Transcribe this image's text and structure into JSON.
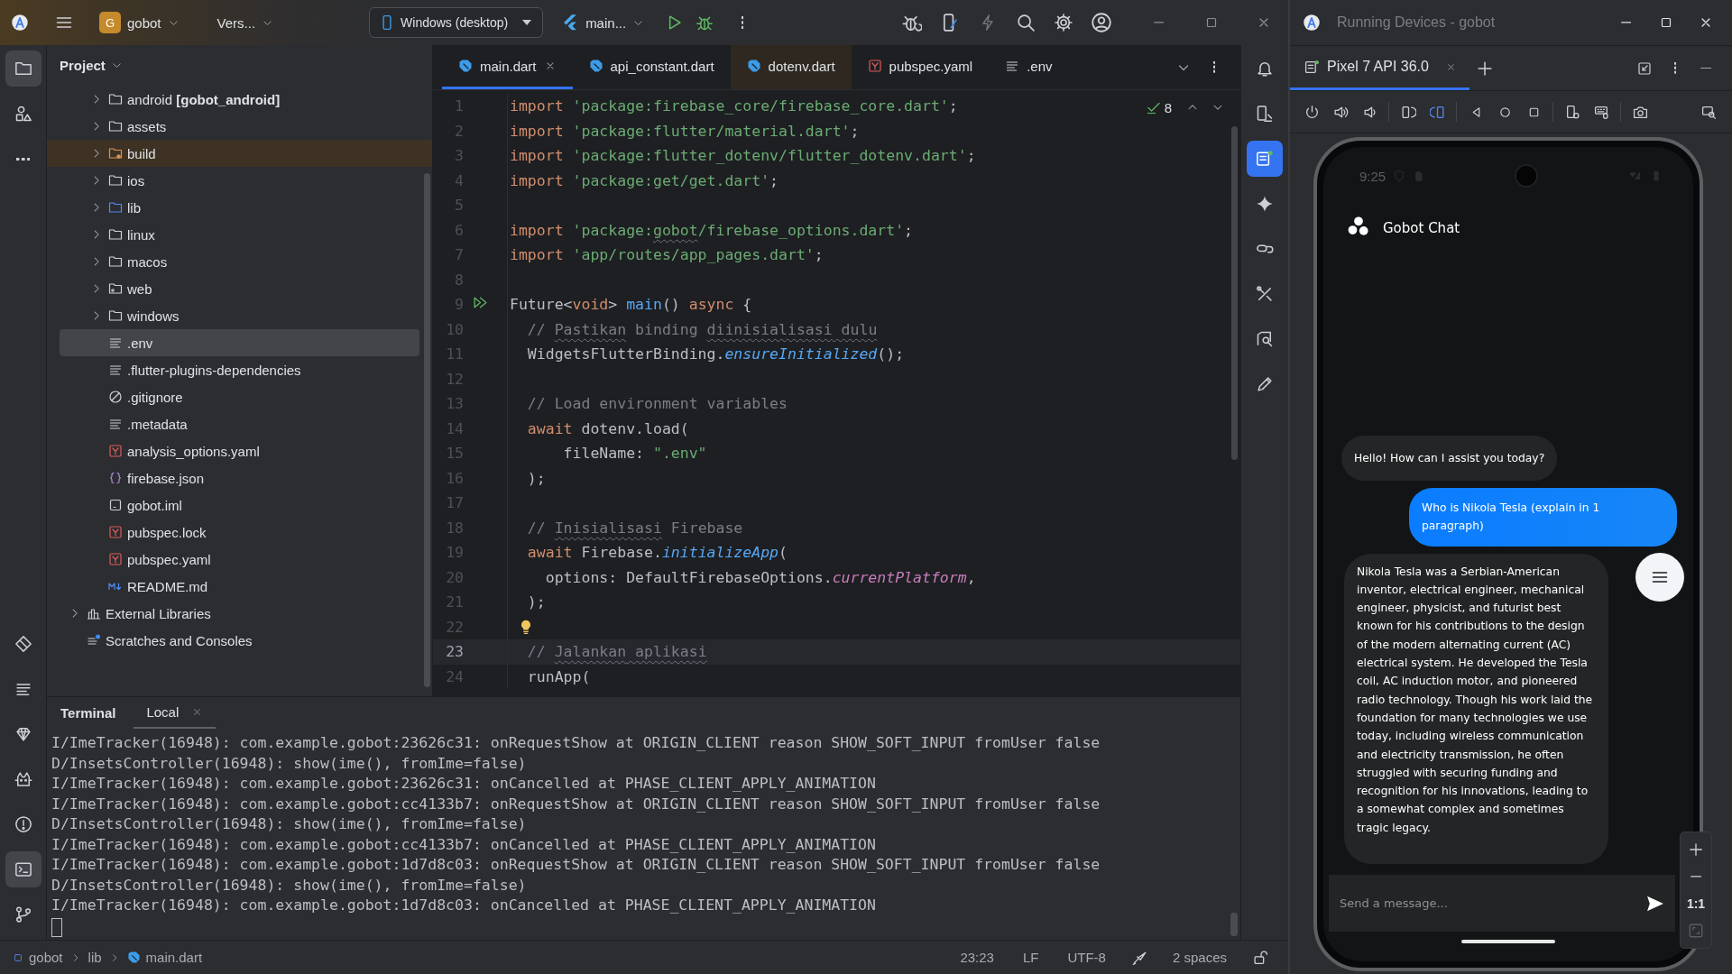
{
  "topbar": {
    "project": {
      "badge": "G",
      "name": "gobot"
    },
    "vcs": "Vers...",
    "device": "Windows (desktop)",
    "run_config": "main..."
  },
  "left_toolbar": {
    "top": [
      {
        "kind": "project",
        "selected": true
      },
      {
        "kind": "shapes",
        "selected": false
      },
      {
        "kind": "more",
        "selected": false
      }
    ],
    "bottom": [
      {
        "kind": "tag",
        "selected": false
      },
      {
        "kind": "structure",
        "selected": false
      },
      {
        "kind": "gem",
        "selected": false
      },
      {
        "kind": "cat",
        "selected": false
      },
      {
        "kind": "alert",
        "selected": false
      },
      {
        "kind": "terminal",
        "selected": true
      },
      {
        "kind": "git",
        "selected": false
      }
    ]
  },
  "project": {
    "title": "Project",
    "files": [
      {
        "label": "android **[gobot_android]**",
        "kind": "folder",
        "expandable": true,
        "selected": false,
        "excluded": false
      },
      {
        "label": "assets",
        "kind": "folder",
        "expandable": true,
        "selected": false,
        "excluded": false
      },
      {
        "label": "build",
        "kind": "folder_excluded",
        "expandable": true,
        "selected": false,
        "excluded": true
      },
      {
        "label": "ios",
        "kind": "folder",
        "expandable": true,
        "selected": false,
        "excluded": false
      },
      {
        "label": "lib",
        "kind": "folder_source",
        "expandable": true,
        "selected": false,
        "excluded": false
      },
      {
        "label": "linux",
        "kind": "folder",
        "expandable": true,
        "selected": false,
        "excluded": false
      },
      {
        "label": "macos",
        "kind": "folder",
        "expandable": true,
        "selected": false,
        "excluded": false
      },
      {
        "label": "web",
        "kind": "folder_web",
        "expandable": true,
        "selected": false,
        "excluded": false
      },
      {
        "label": "windows",
        "kind": "folder",
        "expandable": true,
        "selected": false,
        "excluded": false
      },
      {
        "label": ".env",
        "kind": "text",
        "expandable": false,
        "selected": true,
        "excluded": false
      },
      {
        "label": ".flutter-plugins-dependencies",
        "kind": "text",
        "expandable": false,
        "selected": false,
        "excluded": false
      },
      {
        "label": ".gitignore",
        "kind": "ignore",
        "expandable": false,
        "selected": false,
        "excluded": false
      },
      {
        "label": ".metadata",
        "kind": "text",
        "expandable": false,
        "selected": false,
        "excluded": false
      },
      {
        "label": "analysis_options.yaml",
        "kind": "yaml",
        "expandable": false,
        "selected": false,
        "excluded": false
      },
      {
        "label": "firebase.json",
        "kind": "json",
        "expandable": false,
        "selected": false,
        "excluded": false
      },
      {
        "label": "gobot.iml",
        "kind": "module",
        "expandable": false,
        "selected": false,
        "excluded": false
      },
      {
        "label": "pubspec.lock",
        "kind": "yaml",
        "expandable": false,
        "selected": false,
        "excluded": false
      },
      {
        "label": "pubspec.yaml",
        "kind": "yaml",
        "expandable": false,
        "selected": false,
        "excluded": false
      },
      {
        "label": "README.md",
        "kind": "markdown",
        "expandable": false,
        "selected": false,
        "excluded": false
      }
    ],
    "other_roots": [
      {
        "label": "External Libraries",
        "kind": "libraries",
        "expandable": true,
        "selected": false,
        "excluded": false
      },
      {
        "label": "Scratches and Consoles",
        "kind": "scratches",
        "expandable": false,
        "selected": false,
        "excluded": false
      }
    ]
  },
  "editor": {
    "tabs": [
      {
        "label": "main.dart",
        "kind": "dart",
        "selected": true,
        "modified": false
      },
      {
        "label": "api_constant.dart",
        "kind": "dart",
        "selected": false,
        "modified": false
      },
      {
        "label": "dotenv.dart",
        "kind": "dart",
        "selected": false,
        "modified": true
      },
      {
        "label": "pubspec.yaml",
        "kind": "yaml",
        "selected": false,
        "modified": false
      },
      {
        "label": ".env",
        "kind": "text",
        "selected": false,
        "modified": false
      }
    ],
    "inspection_count": "8",
    "lines": [
      {
        "number": "1",
        "kind": "code",
        "current": false,
        "tokens": [
          {
            "text": "import ",
            "kind": "kw"
          },
          {
            "text": "'package:firebase_core/firebase_core.dart'",
            "kind": "str"
          },
          {
            "text": ";",
            "kind": "plain"
          }
        ]
      },
      {
        "number": "2",
        "kind": "code",
        "current": false,
        "tokens": [
          {
            "text": "import ",
            "kind": "kw"
          },
          {
            "text": "'package:flutter/material.dart'",
            "kind": "str"
          },
          {
            "text": ";",
            "kind": "plain"
          }
        ]
      },
      {
        "number": "3",
        "kind": "code",
        "current": false,
        "tokens": [
          {
            "text": "import ",
            "kind": "kw"
          },
          {
            "text": "'package:flutter_dotenv/flutter_dotenv.dart'",
            "kind": "str"
          },
          {
            "text": ";",
            "kind": "plain"
          }
        ]
      },
      {
        "number": "4",
        "kind": "code",
        "current": false,
        "tokens": [
          {
            "text": "import ",
            "kind": "kw"
          },
          {
            "text": "'package:get/get.dart'",
            "kind": "str"
          },
          {
            "text": ";",
            "kind": "plain"
          }
        ]
      },
      {
        "number": "5",
        "kind": "code",
        "current": false
      },
      {
        "number": "6",
        "kind": "code",
        "current": false,
        "tokens": [
          {
            "text": "import ",
            "kind": "kw"
          },
          {
            "text": "'package:",
            "kind": "str"
          },
          {
            "text": "gobot",
            "kind": "str_typo"
          },
          {
            "text": "/firebase_options.dart'",
            "kind": "str"
          },
          {
            "text": ";",
            "kind": "plain"
          }
        ]
      },
      {
        "number": "7",
        "kind": "code",
        "current": false,
        "tokens": [
          {
            "text": "import ",
            "kind": "kw"
          },
          {
            "text": "'app/routes/app_pages.dart'",
            "kind": "str"
          },
          {
            "text": ";",
            "kind": "plain"
          }
        ]
      },
      {
        "number": "8",
        "kind": "code",
        "current": false
      },
      {
        "number": "9",
        "kind": "entry",
        "current": false,
        "tokens": [
          {
            "text": "Future<",
            "kind": "plain"
          },
          {
            "text": "void",
            "kind": "kw"
          },
          {
            "text": "> ",
            "kind": "plain"
          },
          {
            "text": "main",
            "kind": "fn"
          },
          {
            "text": "() ",
            "kind": "plain"
          },
          {
            "text": "async",
            "kind": "kw"
          },
          {
            "text": " {",
            "kind": "plain"
          }
        ]
      },
      {
        "number": "10",
        "kind": "code",
        "current": false,
        "tokens": [
          {
            "text": "  // ",
            "kind": "cmt"
          },
          {
            "text": "Pastikan",
            "kind": "cmt_typo"
          },
          {
            "text": " binding ",
            "kind": "cmt"
          },
          {
            "text": "diinisialisasi",
            "kind": "cmt_typo"
          },
          {
            "text": " dulu",
            "kind": "cmt_typo_spaced"
          }
        ]
      },
      {
        "number": "11",
        "kind": "code",
        "current": false,
        "tokens": [
          {
            "text": "  WidgetsFlutterBinding.",
            "kind": "plain"
          },
          {
            "text": "ensureInitialized",
            "kind": "call"
          },
          {
            "text": "();",
            "kind": "plain"
          }
        ]
      },
      {
        "number": "12",
        "kind": "code",
        "current": false
      },
      {
        "number": "13",
        "kind": "code",
        "current": false,
        "tokens": [
          {
            "text": "  // Load environment variables",
            "kind": "cmt"
          }
        ]
      },
      {
        "number": "14",
        "kind": "code",
        "current": false,
        "tokens": [
          {
            "text": "  await ",
            "kind": "kw"
          },
          {
            "text": "dotenv.load(",
            "kind": "plain"
          }
        ]
      },
      {
        "number": "15",
        "kind": "code",
        "current": false,
        "tokens": [
          {
            "text": "      fileName: ",
            "kind": "plain"
          },
          {
            "text": "\".env\"",
            "kind": "str"
          }
        ]
      },
      {
        "number": "16",
        "kind": "code",
        "current": false,
        "tokens": [
          {
            "text": "  );",
            "kind": "plain"
          }
        ]
      },
      {
        "number": "17",
        "kind": "code",
        "current": false
      },
      {
        "number": "18",
        "kind": "code",
        "current": false,
        "tokens": [
          {
            "text": "  // ",
            "kind": "cmt"
          },
          {
            "text": "Inisialisasi",
            "kind": "cmt_typo"
          },
          {
            "text": " Firebase",
            "kind": "cmt"
          }
        ]
      },
      {
        "number": "19",
        "kind": "code",
        "current": false,
        "tokens": [
          {
            "text": "  await ",
            "kind": "kw"
          },
          {
            "text": "Firebase.",
            "kind": "plain"
          },
          {
            "text": "initializeApp",
            "kind": "call"
          },
          {
            "text": "(",
            "kind": "plain"
          }
        ]
      },
      {
        "number": "20",
        "kind": "code",
        "current": false,
        "tokens": [
          {
            "text": "    options: DefaultFirebaseOptions.",
            "kind": "plain"
          },
          {
            "text": "currentPlatform",
            "kind": "field"
          },
          {
            "text": ",",
            "kind": "plain"
          }
        ]
      },
      {
        "number": "21",
        "kind": "code",
        "current": false,
        "tokens": [
          {
            "text": "  );",
            "kind": "plain"
          }
        ]
      },
      {
        "number": "22",
        "kind": "hint",
        "current": false
      },
      {
        "number": "23",
        "kind": "code",
        "current": true,
        "tokens": [
          {
            "text": "  // ",
            "kind": "cmt"
          },
          {
            "text": "Jalankan",
            "kind": "cmt_typo"
          },
          {
            "text": " aplikasi",
            "kind": "cmt_typo_spaced"
          }
        ]
      },
      {
        "number": "24",
        "kind": "code",
        "current": false,
        "tokens": [
          {
            "text": "  runApp(",
            "kind": "plain"
          }
        ]
      }
    ]
  },
  "right_toolbar": [
    {
      "kind": "bell",
      "selected": false
    },
    {
      "kind": "device_manager",
      "selected": false
    },
    {
      "kind": "running_devices",
      "selected": true
    },
    {
      "kind": "sparkle",
      "selected": false
    },
    {
      "kind": "link",
      "selected": false
    },
    {
      "kind": "tools",
      "selected": false
    },
    {
      "kind": "inspection",
      "selected": false
    },
    {
      "kind": "pencil",
      "selected": false
    }
  ],
  "terminal": {
    "title": "Terminal",
    "tabs": [
      {
        "label": "Local",
        "selected": true
      }
    ],
    "lines": [
      "I/ImeTracker(16948): com.example.gobot:23626c31: onRequestShow at ORIGIN_CLIENT reason SHOW_SOFT_INPUT fromUser false",
      "D/InsetsController(16948): show(ime(), fromIme=false)",
      "I/ImeTracker(16948): com.example.gobot:23626c31: onCancelled at PHASE_CLIENT_APPLY_ANIMATION",
      "I/ImeTracker(16948): com.example.gobot:cc4133b7: onRequestShow at ORIGIN_CLIENT reason SHOW_SOFT_INPUT fromUser false",
      "D/InsetsController(16948): show(ime(), fromIme=false)",
      "I/ImeTracker(16948): com.example.gobot:cc4133b7: onCancelled at PHASE_CLIENT_APPLY_ANIMATION",
      "I/ImeTracker(16948): com.example.gobot:1d7d8c03: onRequestShow at ORIGIN_CLIENT reason SHOW_SOFT_INPUT fromUser false",
      "D/InsetsController(16948): show(ime(), fromIme=false)",
      "I/ImeTracker(16948): com.example.gobot:1d7d8c03: onCancelled at PHASE_CLIENT_APPLY_ANIMATION"
    ]
  },
  "status_bar": {
    "breadcrumbs": [
      {
        "label": "gobot",
        "kind": "module"
      },
      {
        "label": "lib",
        "kind": "folder"
      },
      {
        "label": "main.dart",
        "kind": "dart"
      }
    ],
    "position": "23:23",
    "line_separator": "LF",
    "encoding": "UTF-8",
    "indent": "2 spaces"
  },
  "devices_window": {
    "title": "Running Devices - gobot",
    "tabs": [
      {
        "label": "Pixel 7 API 36.0",
        "selected": true
      }
    ],
    "phone": {
      "clock": "9:25",
      "app_title": "Gobot Chat",
      "messages": [
        {
          "kind": "bot",
          "text": "Hello! How can I assist you today?"
        },
        {
          "kind": "user",
          "text": "Who is Nikola Tesla (explain in 1 paragraph)"
        },
        {
          "kind": "bot",
          "text": "Nikola Tesla was a Serbian-American inventor, electrical engineer, mechanical engineer, physicist, and futurist best known for his contributions to the design of the modern alternating current (AC) electrical system. He developed the Tesla coil, AC induction motor, and pioneered radio technology. Though his work laid the foundation for many technologies we use today, including wireless communication and electricity transmission, he often struggled with securing funding and recognition for his innovations, leading to a somewhat complex and sometimes tragic legacy."
        }
      ],
      "input": {
        "placeholder": "Send a message..."
      }
    },
    "zoom_reset": "1:1"
  }
}
